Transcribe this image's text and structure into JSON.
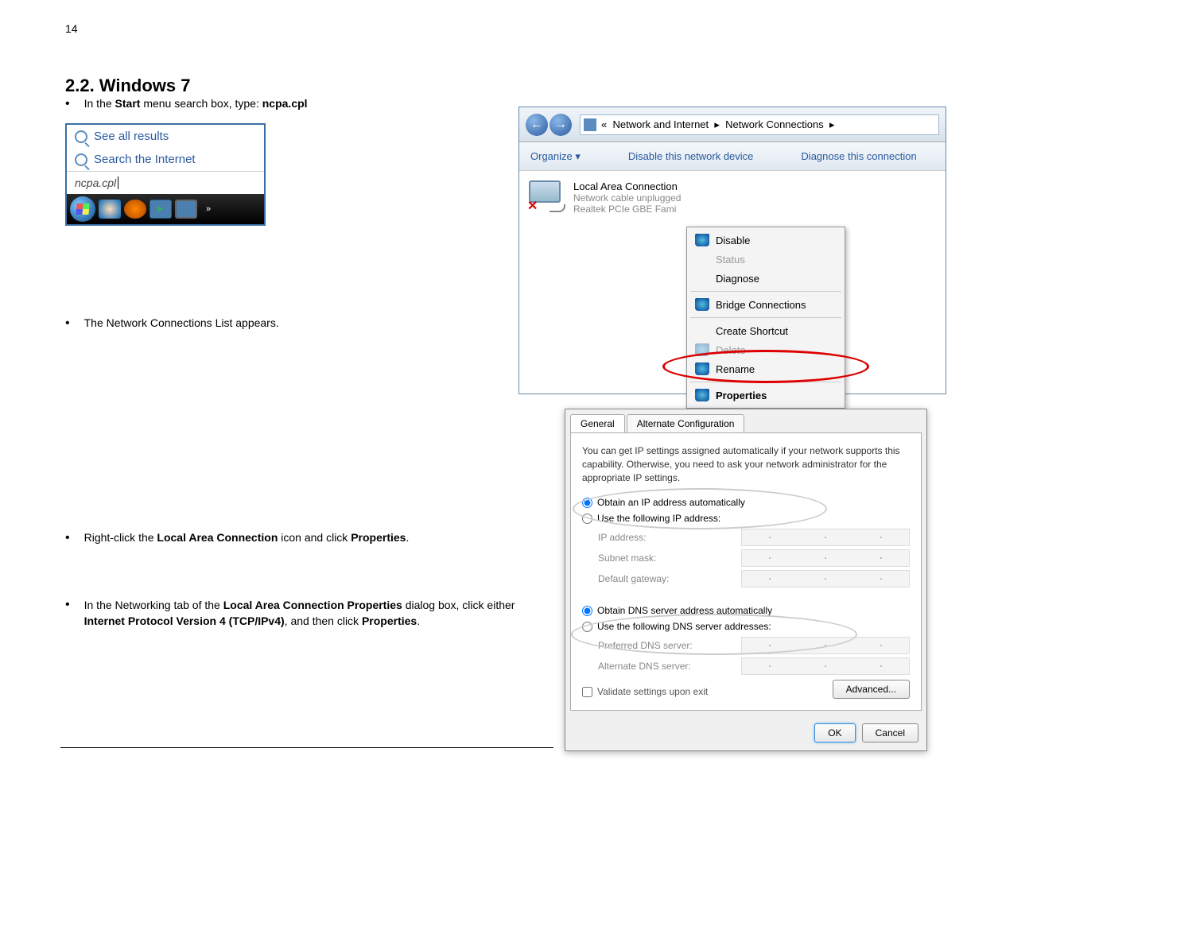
{
  "page_number": "14",
  "heading": "2.2.    Windows 7",
  "bullets": {
    "b1_pre": "In the ",
    "b1_bold1": "Start",
    "b1_mid": " menu search box, type: ",
    "b1_bold2": "ncpa.cpl",
    "b2": "The Network Connections List appears.",
    "b3_pre": "Right-click the ",
    "b3_bold1": "Local Area Connection",
    "b3_mid": " icon and click ",
    "b3_bold2": "Properties",
    "b3_post": ".",
    "b4_pre": "In the Networking tab of the ",
    "b4_bold1": "Local Area Connection Properties",
    "b4_mid": " dialog box, click either ",
    "b4_bold2": "Internet Protocol Version 4 (TCP/IPv4)",
    "b4_mid2": ", and then click ",
    "b4_bold3": "Properties",
    "b4_post": "."
  },
  "start_menu": {
    "see_all": "See all results",
    "search_internet": "Search the Internet",
    "input": "ncpa.cpl",
    "more": "»"
  },
  "nc_window": {
    "bc_sep": "«",
    "bc1": "Network and Internet",
    "bc_arrow": "▸",
    "bc2": "Network Connections",
    "organize": "Organize ▾",
    "disable_device": "Disable this network device",
    "diagnose_conn": "Diagnose this connection",
    "lac_title": "Local Area Connection",
    "lac_status": "Network cable unplugged",
    "lac_adapter": "Realtek PCIe GBE Fami"
  },
  "ctx": {
    "disable": "Disable",
    "status": "Status",
    "diagnose": "Diagnose",
    "bridge": "Bridge Connections",
    "shortcut": "Create Shortcut",
    "delete": "Delete",
    "rename": "Rename",
    "properties": "Properties"
  },
  "ipv4": {
    "tab_general": "General",
    "tab_alt": "Alternate Configuration",
    "desc": "You can get IP settings assigned automatically if your network supports this capability. Otherwise, you need to ask your network administrator for the appropriate IP settings.",
    "r_auto_ip": "Obtain an IP address automatically",
    "r_manual_ip": "Use the following IP address:",
    "ip_addr": "IP address:",
    "subnet": "Subnet mask:",
    "gateway": "Default gateway:",
    "r_auto_dns": "Obtain DNS server address automatically",
    "r_manual_dns": "Use the following DNS server addresses:",
    "pref_dns": "Preferred DNS server:",
    "alt_dns": "Alternate DNS server:",
    "validate": "Validate settings upon exit",
    "advanced": "Advanced...",
    "ok": "OK",
    "cancel": "Cancel"
  }
}
